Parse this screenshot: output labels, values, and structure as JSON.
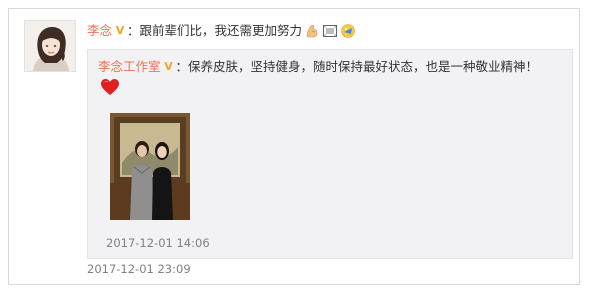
{
  "post": {
    "author": "李念",
    "text": "：跟前辈们比，我还需更加努力",
    "timestamp": "2017-12-01 23:09",
    "emojis": [
      "muscle-arm-icon",
      "film-frame-icon",
      "moon-cheer-icon"
    ],
    "verified_icon": "vip-v-icon"
  },
  "quoted_post": {
    "author": "李念工作室",
    "text": "：保养皮肤，坚持健身，随时保持最好状态，也是一种敬业精神！",
    "timestamp": "2017-12-01 14:06",
    "emojis": [
      "heart-icon"
    ],
    "verified_icon": "vip-v-icon"
  },
  "colors": {
    "author_link": "#eb7350",
    "timestamp": "#808080",
    "quote_background": "#f2f2f5",
    "badge": "#f5a623",
    "heart": "#e02020"
  }
}
